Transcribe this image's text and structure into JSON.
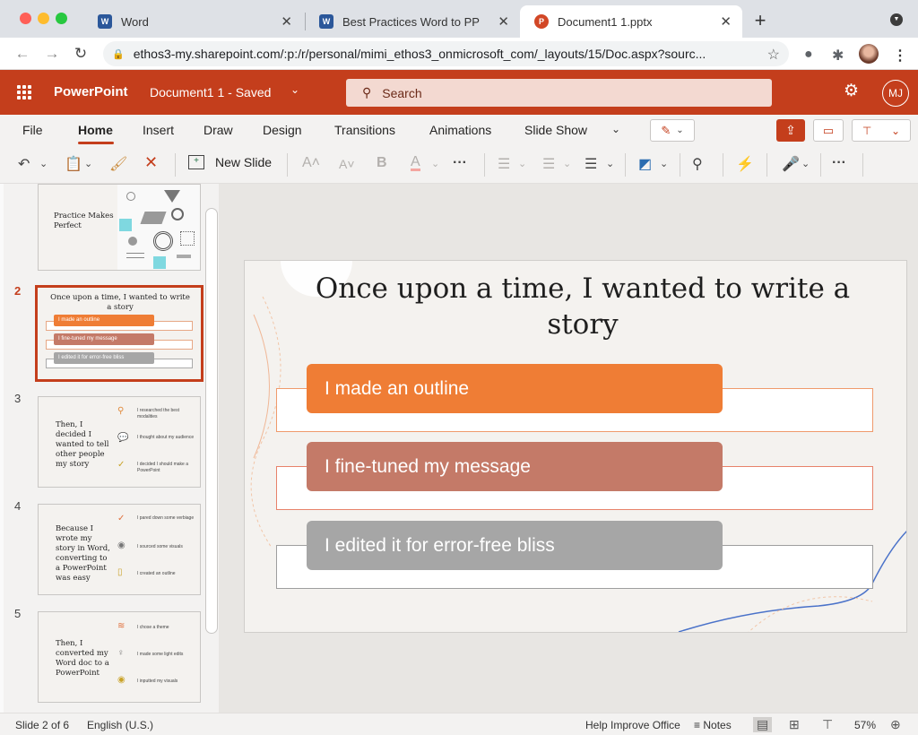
{
  "browser": {
    "tabs": [
      {
        "title": "Word",
        "favicon": "W"
      },
      {
        "title": "Best Practices Word to PP",
        "favicon": "W"
      },
      {
        "title": "Document1 1.pptx",
        "favicon": "P"
      }
    ],
    "url": "ethos3-my.sharepoint.com/:p:/r/personal/mimi_ethos3_onmicrosoft_com/_layouts/15/Doc.aspx?sourc..."
  },
  "app": {
    "name": "PowerPoint",
    "doc_title": "Document1 1 - Saved",
    "search_placeholder": "Search",
    "user_initials": "MJ",
    "brand_color": "#c43e1c"
  },
  "ribbon": {
    "tabs": [
      "File",
      "Home",
      "Insert",
      "Draw",
      "Design",
      "Transitions",
      "Animations",
      "Slide Show"
    ],
    "active_tab": "Home",
    "new_slide_label": "New Slide"
  },
  "thumbnails": [
    {
      "number": "",
      "title": "Practice Makes Perfect"
    },
    {
      "number": "2",
      "title": "Once upon a time, I wanted to write a story",
      "items": [
        "I made an outline",
        "I fine-tuned my message",
        "I edited it for error-free bliss"
      ]
    },
    {
      "number": "3",
      "title": "Then, I decided I wanted to tell other people my story",
      "items": [
        "I researched the best modalities",
        "I thought about my audience",
        "I decided I should make a PowerPoint"
      ]
    },
    {
      "number": "4",
      "title": "Because I wrote my story in Word, converting to a PowerPoint was easy",
      "items": [
        "I pared down some verbiage",
        "I sourced some visuals",
        "I created an outline"
      ]
    },
    {
      "number": "5",
      "title": "Then, I converted my Word doc to a PowerPoint",
      "items": [
        "I chose a theme",
        "I made some light edits",
        "I inputted my visuals"
      ]
    }
  ],
  "slide": {
    "title": "Once upon a time, I wanted to write a story",
    "items": [
      {
        "label": "I made an outline",
        "color": "#ef7d35",
        "outline": "#ef9a6c"
      },
      {
        "label": "I fine-tuned my message",
        "color": "#c47a68",
        "outline": "#e8826a"
      },
      {
        "label": "I edited it for error-free bliss",
        "color": "#a6a6a6",
        "outline": "#9e9e9e"
      }
    ]
  },
  "status": {
    "slide_indicator": "Slide 2 of 6",
    "language": "English (U.S.)",
    "help": "Help Improve Office",
    "notes": "Notes",
    "zoom": "57%"
  }
}
